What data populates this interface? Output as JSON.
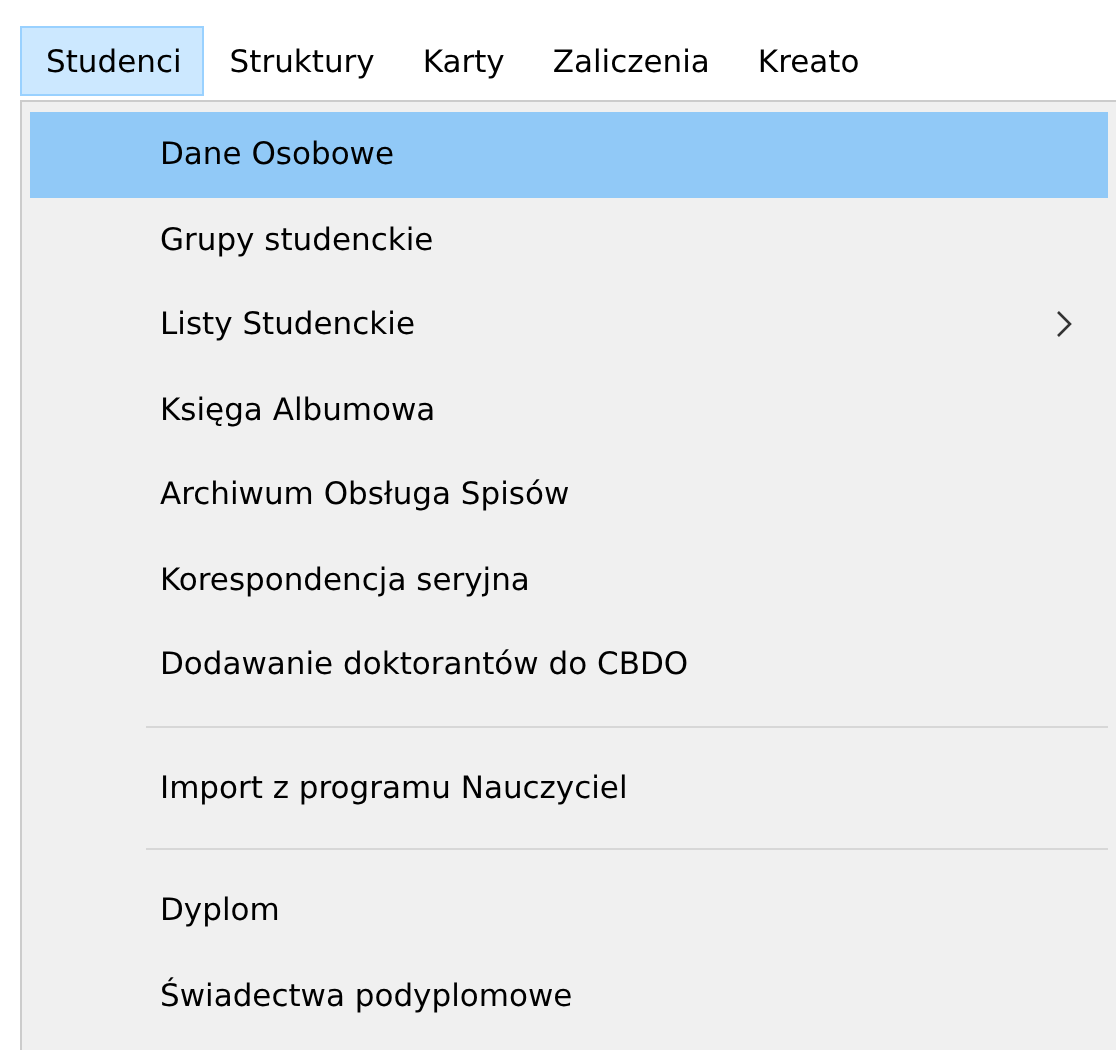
{
  "menu_bar": [
    {
      "label": "Studenci",
      "selected": true
    },
    {
      "label": "Struktury",
      "selected": false
    },
    {
      "label": "Karty",
      "selected": false
    },
    {
      "label": "Zaliczenia",
      "selected": false
    },
    {
      "label": "Kreato",
      "selected": false
    }
  ],
  "dropdown": [
    {
      "kind": "item",
      "label": "Dane Osobowe",
      "selected": true,
      "submenu": false
    },
    {
      "kind": "item",
      "label": "Grupy studenckie",
      "selected": false,
      "submenu": false
    },
    {
      "kind": "item",
      "label": "Listy Studenckie",
      "selected": false,
      "submenu": true
    },
    {
      "kind": "item",
      "label": "Księga Albumowa",
      "selected": false,
      "submenu": false
    },
    {
      "kind": "item",
      "label": "Archiwum Obsługa Spisów",
      "selected": false,
      "submenu": false
    },
    {
      "kind": "item",
      "label": "Korespondencja seryjna",
      "selected": false,
      "submenu": false
    },
    {
      "kind": "item",
      "label": "Dodawanie doktorantów do CBDO",
      "selected": false,
      "submenu": false
    },
    {
      "kind": "separator"
    },
    {
      "kind": "item",
      "label": "Import z programu Nauczyciel",
      "selected": false,
      "submenu": false
    },
    {
      "kind": "separator"
    },
    {
      "kind": "item",
      "label": "Dyplom",
      "selected": false,
      "submenu": false
    },
    {
      "kind": "item",
      "label": "Świadectwa podyplomowe",
      "selected": false,
      "submenu": false
    }
  ]
}
